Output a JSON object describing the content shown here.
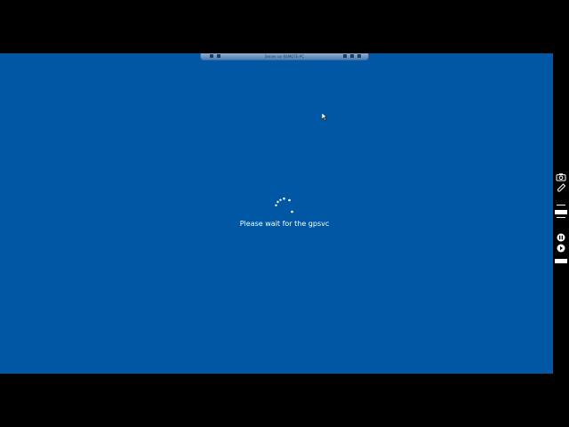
{
  "remote_session": {
    "title": "Server on REMOTE-PC"
  },
  "screen": {
    "background": "#0057a3",
    "status_message": "Please wait for the gpsvc",
    "icons": {
      "spinner": "loading-spinner",
      "cursor": "mouse-pointer-icon"
    }
  },
  "recorder_sidebar": {
    "icons": [
      "camera-icon",
      "pen-icon",
      "record-indicator",
      "pause-icon",
      "play-icon"
    ]
  }
}
